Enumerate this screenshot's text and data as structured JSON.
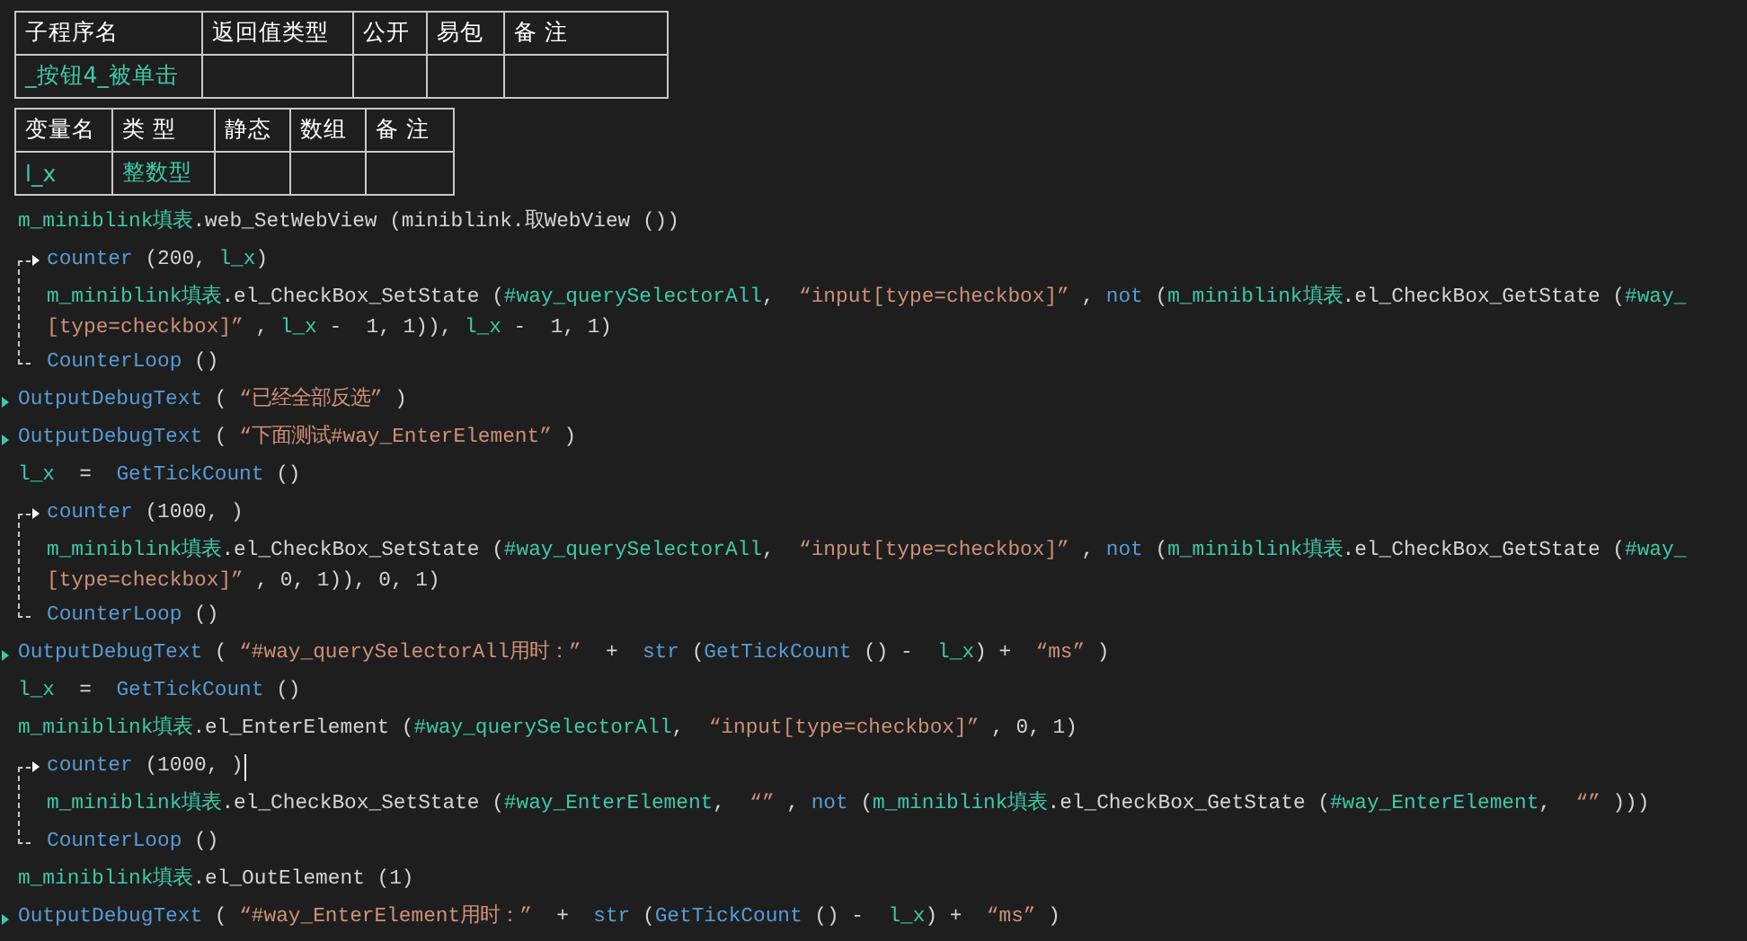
{
  "subroutine_table": {
    "columns": [
      "子程序名",
      "返回值类型",
      "公开",
      "易包",
      "备 注"
    ],
    "rows": [
      [
        "_按钮4_被单击"
      ]
    ]
  },
  "variable_table": {
    "columns": [
      "变量名",
      "类 型",
      "静态",
      "数组",
      "备 注"
    ],
    "rows": [
      [
        "l_x",
        "整数型"
      ]
    ]
  },
  "code": [
    {
      "kind": "line",
      "arrow": false,
      "tokens": [
        {
          "kind": "id",
          "text": "m_miniblink填表"
        },
        {
          "kind": "plain",
          "text": ".web_SetWebView (miniblink.取WebView ())"
        }
      ]
    },
    {
      "kind": "loop",
      "caret": false,
      "header": [
        {
          "kind": "fn",
          "text": "counter"
        },
        {
          "kind": "plain",
          "text": " ("
        },
        {
          "kind": "num",
          "text": "200"
        },
        {
          "kind": "plain",
          "text": ", "
        },
        {
          "kind": "id",
          "text": "l_x"
        },
        {
          "kind": "plain",
          "text": ")"
        }
      ],
      "body": [
        [
          {
            "kind": "id",
            "text": "m_miniblink填表"
          },
          {
            "kind": "plain",
            "text": ".el_CheckBox_SetState ("
          },
          {
            "kind": "id",
            "text": "#way_querySelectorAll"
          },
          {
            "kind": "plain",
            "text": ",  "
          },
          {
            "kind": "str",
            "text": "“input[type=checkbox]”"
          },
          {
            "kind": "plain",
            "text": " , "
          },
          {
            "kind": "fn",
            "text": "not"
          },
          {
            "kind": "plain",
            "text": " ("
          },
          {
            "kind": "id",
            "text": "m_miniblink填表"
          },
          {
            "kind": "plain",
            "text": ".el_CheckBox_GetState ("
          },
          {
            "kind": "id",
            "text": "#way_"
          }
        ],
        [
          {
            "kind": "str",
            "text": "[type=checkbox]”"
          },
          {
            "kind": "plain",
            "text": " , "
          },
          {
            "kind": "id",
            "text": "l_x"
          },
          {
            "kind": "plain",
            "text": " -  "
          },
          {
            "kind": "num",
            "text": "1"
          },
          {
            "kind": "plain",
            "text": ", "
          },
          {
            "kind": "num",
            "text": "1"
          },
          {
            "kind": "plain",
            "text": ")), "
          },
          {
            "kind": "id",
            "text": "l_x"
          },
          {
            "kind": "plain",
            "text": " -  "
          },
          {
            "kind": "num",
            "text": "1"
          },
          {
            "kind": "plain",
            "text": ", "
          },
          {
            "kind": "num",
            "text": "1"
          },
          {
            "kind": "plain",
            "text": ")"
          }
        ]
      ],
      "footer": [
        {
          "kind": "fn",
          "text": "CounterLoop"
        },
        {
          "kind": "plain",
          "text": " ()"
        }
      ]
    },
    {
      "kind": "line",
      "arrow": true,
      "tokens": [
        {
          "kind": "fn",
          "text": "OutputDebugText"
        },
        {
          "kind": "plain",
          "text": " ( "
        },
        {
          "kind": "str",
          "text": "“已经全部反选”"
        },
        {
          "kind": "plain",
          "text": " )"
        }
      ]
    },
    {
      "kind": "line",
      "arrow": true,
      "tokens": [
        {
          "kind": "fn",
          "text": "OutputDebugText"
        },
        {
          "kind": "plain",
          "text": " ( "
        },
        {
          "kind": "str",
          "text": "“下面测试#way_EnterElement”"
        },
        {
          "kind": "plain",
          "text": " )"
        }
      ]
    },
    {
      "kind": "line",
      "arrow": false,
      "tokens": [
        {
          "kind": "id",
          "text": "l_x"
        },
        {
          "kind": "plain",
          "text": "  =  "
        },
        {
          "kind": "fn",
          "text": "GetTickCount"
        },
        {
          "kind": "plain",
          "text": " ()"
        }
      ]
    },
    {
      "kind": "loop",
      "caret": false,
      "header": [
        {
          "kind": "fn",
          "text": "counter"
        },
        {
          "kind": "plain",
          "text": " ("
        },
        {
          "kind": "num",
          "text": "1000"
        },
        {
          "kind": "plain",
          "text": ", )"
        }
      ],
      "body": [
        [
          {
            "kind": "id",
            "text": "m_miniblink填表"
          },
          {
            "kind": "plain",
            "text": ".el_CheckBox_SetState ("
          },
          {
            "kind": "id",
            "text": "#way_querySelectorAll"
          },
          {
            "kind": "plain",
            "text": ",  "
          },
          {
            "kind": "str",
            "text": "“input[type=checkbox]”"
          },
          {
            "kind": "plain",
            "text": " , "
          },
          {
            "kind": "fn",
            "text": "not"
          },
          {
            "kind": "plain",
            "text": " ("
          },
          {
            "kind": "id",
            "text": "m_miniblink填表"
          },
          {
            "kind": "plain",
            "text": ".el_CheckBox_GetState ("
          },
          {
            "kind": "id",
            "text": "#way_"
          }
        ],
        [
          {
            "kind": "str",
            "text": "[type=checkbox]”"
          },
          {
            "kind": "plain",
            "text": " , "
          },
          {
            "kind": "num",
            "text": "0"
          },
          {
            "kind": "plain",
            "text": ", "
          },
          {
            "kind": "num",
            "text": "1"
          },
          {
            "kind": "plain",
            "text": ")), "
          },
          {
            "kind": "num",
            "text": "0"
          },
          {
            "kind": "plain",
            "text": ", "
          },
          {
            "kind": "num",
            "text": "1"
          },
          {
            "kind": "plain",
            "text": ")"
          }
        ]
      ],
      "footer": [
        {
          "kind": "fn",
          "text": "CounterLoop"
        },
        {
          "kind": "plain",
          "text": " ()"
        }
      ]
    },
    {
      "kind": "line",
      "arrow": true,
      "tokens": [
        {
          "kind": "fn",
          "text": "OutputDebugText"
        },
        {
          "kind": "plain",
          "text": " ( "
        },
        {
          "kind": "str",
          "text": "“#way_querySelectorAll用时：”"
        },
        {
          "kind": "plain",
          "text": "  +  "
        },
        {
          "kind": "fn",
          "text": "str"
        },
        {
          "kind": "plain",
          "text": " ("
        },
        {
          "kind": "fn",
          "text": "GetTickCount"
        },
        {
          "kind": "plain",
          "text": " () -  "
        },
        {
          "kind": "id",
          "text": "l_x"
        },
        {
          "kind": "plain",
          "text": ") +  "
        },
        {
          "kind": "str",
          "text": "“ms”"
        },
        {
          "kind": "plain",
          "text": " )"
        }
      ]
    },
    {
      "kind": "line",
      "arrow": false,
      "tokens": [
        {
          "kind": "id",
          "text": "l_x"
        },
        {
          "kind": "plain",
          "text": "  =  "
        },
        {
          "kind": "fn",
          "text": "GetTickCount"
        },
        {
          "kind": "plain",
          "text": " ()"
        }
      ]
    },
    {
      "kind": "line",
      "arrow": false,
      "tokens": [
        {
          "kind": "id",
          "text": "m_miniblink填表"
        },
        {
          "kind": "plain",
          "text": ".el_EnterElement ("
        },
        {
          "kind": "id",
          "text": "#way_querySelectorAll"
        },
        {
          "kind": "plain",
          "text": ",  "
        },
        {
          "kind": "str",
          "text": "“input[type=checkbox]”"
        },
        {
          "kind": "plain",
          "text": " , "
        },
        {
          "kind": "num",
          "text": "0"
        },
        {
          "kind": "plain",
          "text": ", "
        },
        {
          "kind": "num",
          "text": "1"
        },
        {
          "kind": "plain",
          "text": ")"
        }
      ]
    },
    {
      "kind": "loop",
      "caret": true,
      "header": [
        {
          "kind": "fn",
          "text": "counter"
        },
        {
          "kind": "plain",
          "text": " ("
        },
        {
          "kind": "num",
          "text": "1000"
        },
        {
          "kind": "plain",
          "text": ", )"
        }
      ],
      "body": [
        [
          {
            "kind": "id",
            "text": "m_miniblink填表"
          },
          {
            "kind": "plain",
            "text": ".el_CheckBox_SetState ("
          },
          {
            "kind": "id",
            "text": "#way_EnterElement"
          },
          {
            "kind": "plain",
            "text": ",  "
          },
          {
            "kind": "str",
            "text": "“”"
          },
          {
            "kind": "plain",
            "text": " , "
          },
          {
            "kind": "fn",
            "text": "not"
          },
          {
            "kind": "plain",
            "text": " ("
          },
          {
            "kind": "id",
            "text": "m_miniblink填表"
          },
          {
            "kind": "plain",
            "text": ".el_CheckBox_GetState ("
          },
          {
            "kind": "id",
            "text": "#way_EnterElement"
          },
          {
            "kind": "plain",
            "text": ",  "
          },
          {
            "kind": "str",
            "text": "“”"
          },
          {
            "kind": "plain",
            "text": " )))"
          }
        ]
      ],
      "footer": [
        {
          "kind": "fn",
          "text": "CounterLoop"
        },
        {
          "kind": "plain",
          "text": " ()"
        }
      ]
    },
    {
      "kind": "line",
      "arrow": false,
      "tokens": [
        {
          "kind": "id",
          "text": "m_miniblink填表"
        },
        {
          "kind": "plain",
          "text": ".el_OutElement (1)"
        }
      ]
    },
    {
      "kind": "line",
      "arrow": true,
      "tokens": [
        {
          "kind": "fn",
          "text": "OutputDebugText"
        },
        {
          "kind": "plain",
          "text": " ( "
        },
        {
          "kind": "str",
          "text": "“#way_EnterElement用时：”"
        },
        {
          "kind": "plain",
          "text": "  +  "
        },
        {
          "kind": "fn",
          "text": "str"
        },
        {
          "kind": "plain",
          "text": " ("
        },
        {
          "kind": "fn",
          "text": "GetTickCount"
        },
        {
          "kind": "plain",
          "text": " () -  "
        },
        {
          "kind": "id",
          "text": "l_x"
        },
        {
          "kind": "plain",
          "text": ") +  "
        },
        {
          "kind": "str",
          "text": "“ms”"
        },
        {
          "kind": "plain",
          "text": " )"
        }
      ]
    }
  ]
}
